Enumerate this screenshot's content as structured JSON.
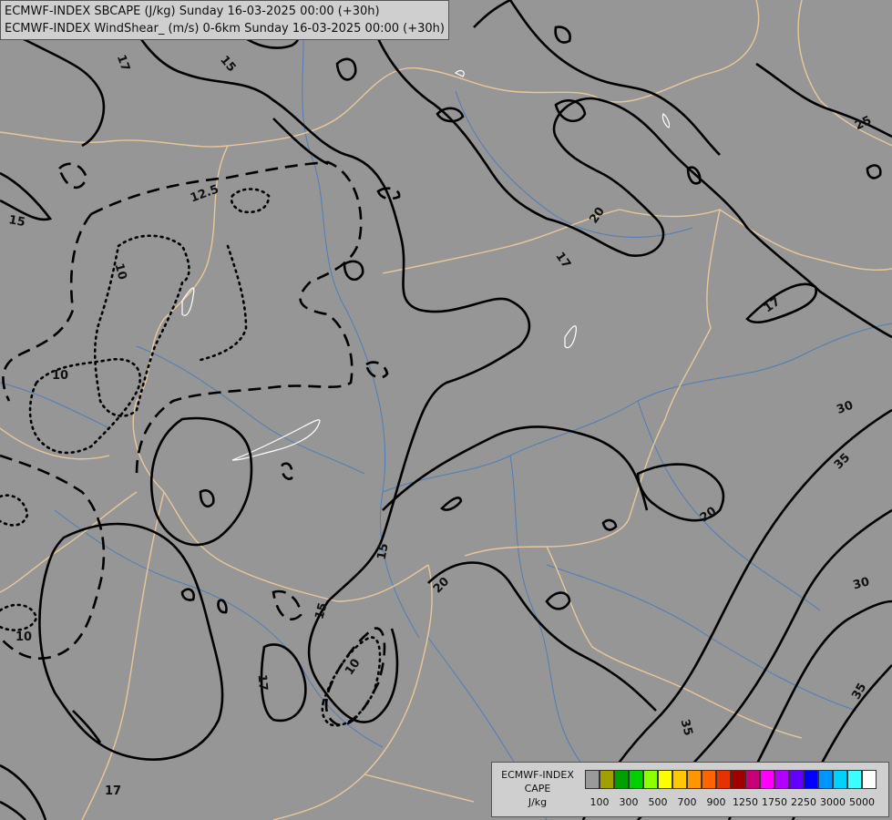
{
  "header": {
    "line1": "ECMWF-INDEX SBCAPE (J/kg) Sunday 16-03-2025 00:00 (+30h)",
    "line2": "ECMWF-INDEX WindShear_ (m/s) 0-6km Sunday 16-03-2025 00:00 (+30h)"
  },
  "legend": {
    "title_line1": "ECMWF-INDEX",
    "title_line2": "CAPE",
    "title_line3": "J/kg",
    "colors": [
      "#9a9a9a",
      "#a0a000",
      "#00a000",
      "#00d200",
      "#8cff00",
      "#ffff00",
      "#ffc800",
      "#ff9600",
      "#ff6400",
      "#e63200",
      "#a00000",
      "#c80078",
      "#ff00ff",
      "#b400ff",
      "#6400ff",
      "#0000ff",
      "#0096ff",
      "#00d2ff",
      "#3cffff",
      "#ffffff"
    ],
    "ticks": [
      "100",
      "300",
      "500",
      "700",
      "900",
      "1250",
      "1750",
      "2250",
      "3000",
      "5000"
    ]
  },
  "contour_labels": {
    "l1": "17",
    "l2": "15",
    "l3": "15",
    "l4": "12.5",
    "l5": "10",
    "l6": "10",
    "l7": "20",
    "l8": "17",
    "l9": "25",
    "l10": "17",
    "l11": "30",
    "l12": "35",
    "l13": "20",
    "l14": "15",
    "l15": "15",
    "l16": "20",
    "l17": "10",
    "l18": "17",
    "l19": "10",
    "l20": "30",
    "l21": "35",
    "l22": "35",
    "l23": "17"
  },
  "map_colors": {
    "background": "#969696",
    "borders": "#e8c89a",
    "rivers": "#4a7ab8",
    "contours": "#000000",
    "lakes": "#ffffff"
  }
}
